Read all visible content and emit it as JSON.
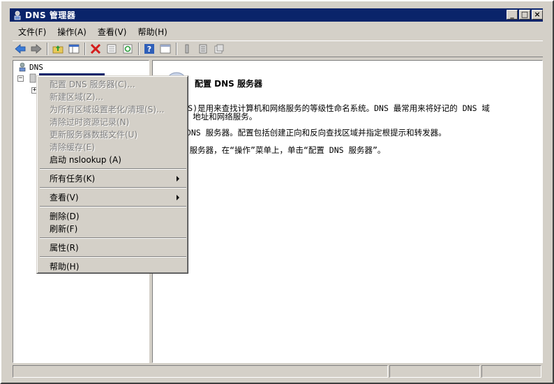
{
  "window": {
    "title": "DNS 管理器",
    "minimize": "_",
    "maximize": "□",
    "close": "×"
  },
  "menubar": {
    "items": [
      "文件(F)",
      "操作(A)",
      "查看(V)",
      "帮助(H)"
    ]
  },
  "toolbar": {
    "icons": [
      "back-icon",
      "forward-icon",
      "up-folder-icon",
      "show-tree-icon",
      "delete-icon",
      "properties-icon",
      "refresh-icon",
      "help-icon",
      "console-icon",
      "server-icon",
      "list-icon",
      "export-icon"
    ]
  },
  "tree": {
    "root_label": "DNS",
    "expander_minus": "−",
    "expander_plus": "+"
  },
  "content": {
    "title": "配置 DNS 服务器",
    "para1_line1": "统(DNS)是用来查找计算机和网络服务的等级性命名系统。DNS 最常用来将好记的 DNS 域",
    "para1_line2": "成 IP 地址和网络服务。",
    "para2": "置此 DNS 服务器。配置包括创建正向和反向查找区域并指定根提示和转发器。",
    "para3": " DNS 服务器，在“操作”菜单上，单击“配置 DNS 服务器”。"
  },
  "context_menu": {
    "configure": "配置 DNS 服务器(C)...",
    "new_zone": "新建区域(Z)...",
    "aging": "为所有区域设置老化/清理(S)...",
    "scavenge": "清除过时资源记录(N)",
    "update_files": "更新服务器数据文件(U)",
    "clear_cache": "清除缓存(E)",
    "nslookup": "启动 nslookup (A)",
    "all_tasks": "所有任务(K)",
    "view": "查看(V)",
    "delete": "删除(D)",
    "refresh": "刷新(F)",
    "properties": "属性(R)",
    "help": "帮助(H)"
  },
  "colors": {
    "titlebar": "#0a246a",
    "face": "#d4d0c8",
    "selection": "#0a246a",
    "disabled_text": "#808080"
  }
}
